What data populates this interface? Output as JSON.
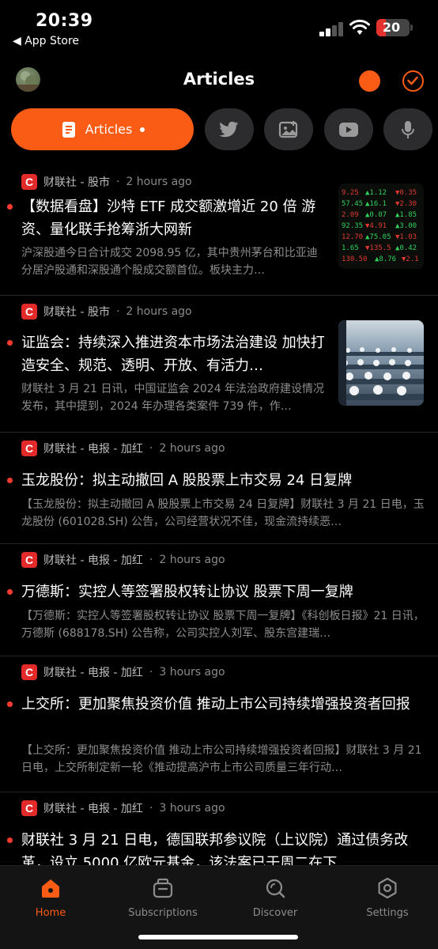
{
  "status": {
    "time": "20:39",
    "back_label": "◀ App Store",
    "battery": "20"
  },
  "header": {
    "title": "Articles"
  },
  "tabs": {
    "articles_label": "Articles",
    "icons": [
      "twitter-icon",
      "image-icon",
      "youtube-icon",
      "microphone-icon"
    ]
  },
  "articles": [
    {
      "source": "财联社 - 股市",
      "time": "2 hours ago",
      "title": "【数据看盘】沙特 ETF 成交额激增近 20 倍 游资、量化联手抢筹浙大网新",
      "excerpt": "沪深股通今日合计成交 2098.95 亿，其中贵州茅台和比亚迪分居沪股通和深股通个股成交额首位。板块主力…",
      "thumb": "stock-board"
    },
    {
      "source": "财联社 - 股市",
      "time": "2 hours ago",
      "title": "证监会：持续深入推进资本市场法治建设 加快打造安全、规范、透明、开放、有活力…",
      "excerpt": "财联社 3 月 21 日讯，中国证监会 2024 年法治政府建设情况发布，其中提到，2024 年办理各类案件 739 件，作…",
      "thumb": "conference"
    },
    {
      "source": "财联社 - 电报 - 加红",
      "time": "2 hours ago",
      "title": "玉龙股份：拟主动撤回 A 股股票上市交易 24 日复牌",
      "excerpt": "【玉龙股份：拟主动撤回 A 股股票上市交易 24 日复牌】财联社 3 月 21 日电，玉龙股份 (601028.SH) 公告，公司经营状况不佳，现金流持续恶…"
    },
    {
      "source": "财联社 - 电报 - 加红",
      "time": "2 hours ago",
      "title": "万德斯：实控人等签署股权转让协议 股票下周一复牌",
      "excerpt": "【万德斯：实控人等签署股权转让协议 股票下周一复牌】《科创板日报》21 日讯，万德斯 (688178.SH) 公告称，公司实控人刘军、股东宫建瑞…"
    },
    {
      "source": "财联社 - 电报 - 加红",
      "time": "3 hours ago",
      "title": "上交所：更加聚焦投资价值 推动上市公司持续增强投资者回报",
      "excerpt": "【上交所：更加聚焦投资价值 推动上市公司持续增强投资者回报】财联社 3 月 21 日电，上交所制定新一轮《推动提高沪市上市公司质量三年行动…"
    },
    {
      "source": "财联社 - 电报 - 加红",
      "time": "3 hours ago",
      "title": "财联社 3 月 21 日电，德国联邦参议院（上议院）通过债务改革，设立 5000 亿欧元基金，该法案已于周二在下…",
      "excerpt": ""
    }
  ],
  "tabbar": {
    "home": "Home",
    "subscriptions": "Subscriptions",
    "discover": "Discover",
    "settings": "Settings"
  },
  "colors": {
    "accent": "#fa5c15",
    "unread": "#ff3b30",
    "source_logo": "#e22a2a",
    "logo_letter": "C"
  }
}
